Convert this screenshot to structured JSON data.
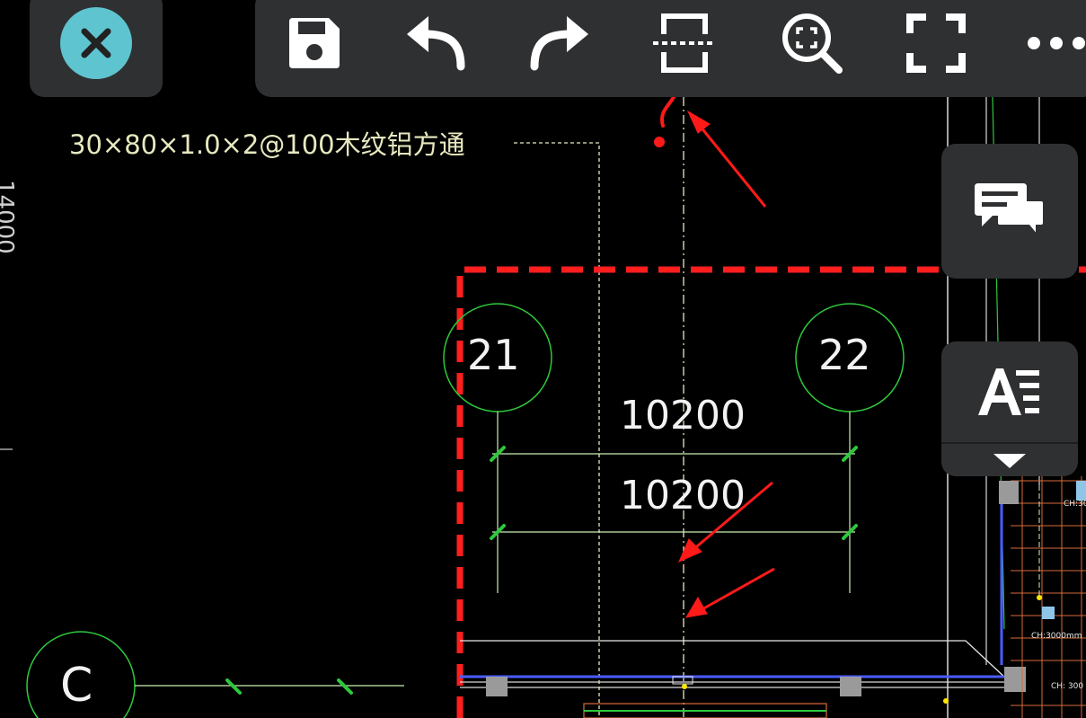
{
  "toolbar": {
    "buttons": [
      {
        "id": "save",
        "icon": "save-icon"
      },
      {
        "id": "undo",
        "icon": "undo-icon"
      },
      {
        "id": "redo",
        "icon": "redo-icon"
      },
      {
        "id": "section",
        "icon": "section-cut-icon"
      },
      {
        "id": "zoom-extents",
        "icon": "zoom-extents-icon"
      },
      {
        "id": "fullscreen",
        "icon": "fullscreen-icon"
      },
      {
        "id": "more",
        "icon": "more-icon"
      }
    ]
  },
  "close": {
    "icon": "close-icon",
    "color": "#5ec4cf"
  },
  "side": {
    "comment_icon": "comment-icon",
    "text_icon": "text-style-icon",
    "expand_icon": "triangle-down-icon"
  },
  "drawing": {
    "note": "30×80×1.0×2@100木纹铝方通",
    "axis_21": "21",
    "axis_22": "22",
    "axis_c": "C",
    "dim_top": "10200",
    "dim_bottom": "10200",
    "left_dim": "14000",
    "room_tag_1": "CH:30",
    "room_tag_2": "CH:3000mm",
    "room_tag_3": "CH: 300"
  },
  "annotation": {
    "question_mark": "?",
    "color": "#ff1a1a"
  },
  "colors": {
    "cad_green": "#2ec83c",
    "revision_red": "#ff1e1e",
    "grid_line": "#c8f0b4"
  }
}
